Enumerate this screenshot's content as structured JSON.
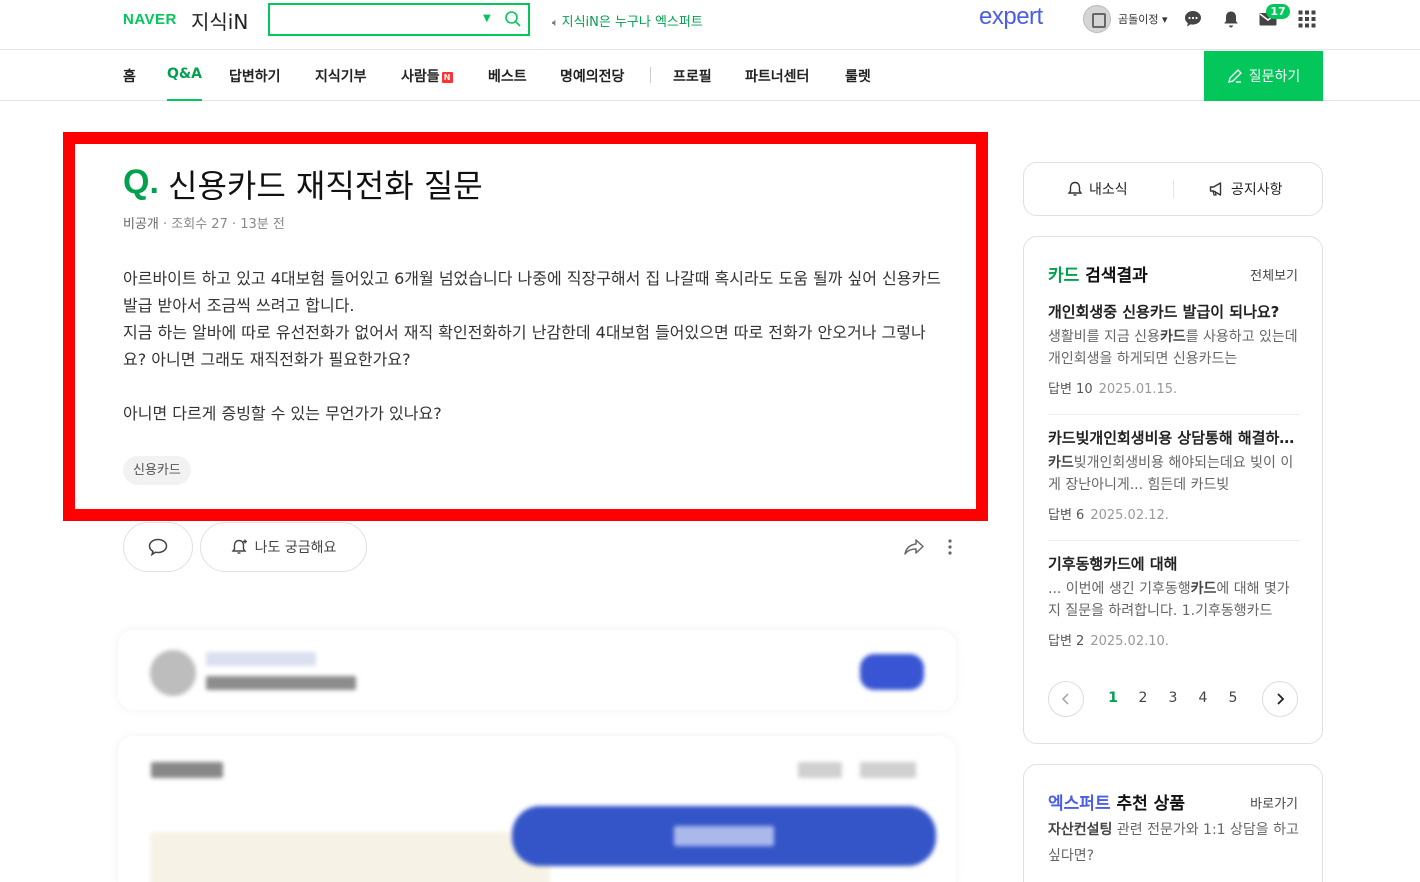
{
  "header": {
    "logo_naver": "NAVER",
    "logo_kin": "지식iN",
    "search_placeholder": "",
    "notice": "지식iN은 누구나 엑스퍼트",
    "expert_logo": "expert",
    "username": "곰돌이정",
    "mail_count": "17"
  },
  "nav": {
    "items": [
      "홈",
      "Q&A",
      "답변하기",
      "지식기부",
      "사람들",
      "베스트",
      "명예의전당",
      "프로필",
      "파트너센터",
      "룰렛"
    ],
    "new_badge": "N",
    "ask_button": "질문하기"
  },
  "question": {
    "q_mark": "Q.",
    "title": "신용카드 재직전화 질문",
    "author": "비공개",
    "views": "조회수 27",
    "time": "13분 전",
    "body_lines": [
      "아르바이트 하고 있고 4대보험 들어있고 6개월 넘었습니다 나중에 직장구해서 집 나갈때 혹시라도 도움 될까 싶어 신용카드 발급 받아서 조금씩 쓰려고 합니다.",
      "지금 하는 알바에 따로 유선전화가 없어서 재직 확인전화하기 난감한데 4대보험 들어있으면 따로 전화가 안오거나 그렇나요? 아니면 그래도 재직전화가 필요한가요?",
      "아니면 다르게 증빙할 수 있는 무언가가 있나요?"
    ],
    "tag": "신용카드",
    "curious_button": "나도 궁금해요"
  },
  "sidebar": {
    "my_news": "내소식",
    "notices": "공지사항",
    "search_keyword": "카드",
    "search_suffix": " 검색결과",
    "view_all": "전체보기",
    "results": [
      {
        "title": "개인회생중 신용카드 발급이 되나요?",
        "snippet_pre": "생활비를 지금 신용",
        "snippet_kw": "카드",
        "snippet_post": "를 사용하고 있는데 개인회생을 하게되면 신용카드는",
        "answers": "답변 10",
        "date": "2025.01.15."
      },
      {
        "title": "카드빚개인회생비용 상담통해 해결하세요",
        "snippet_pre": "",
        "snippet_kw": "카드",
        "snippet_post": "빚개인회생비용 해야되는데요 빚이 이게 장난아니게... 힘든데 카드빚",
        "answers": "답변 6",
        "date": "2025.02.12."
      },
      {
        "title": "기후동행카드에 대해",
        "snippet_pre": "... 이번에 생긴 기후동행",
        "snippet_kw": "카드",
        "snippet_post": "에 대해 몇가지 질문을 하려합니다. 1.기후동행카드",
        "answers": "답변 2",
        "date": "2025.02.10."
      }
    ],
    "pages": [
      "1",
      "2",
      "3",
      "4",
      "5"
    ],
    "expert_keyword": "엑스퍼트",
    "expert_title_rest": " 추천 상품",
    "expert_link": "바로가기",
    "expert_desc_bold": "자산컨설팅",
    "expert_desc_rest": " 관련 전문가와 1:1 상담을 하고 싶다면?"
  },
  "colors": {
    "brand_green": "#03c75a",
    "expert_blue": "#4a5ee8",
    "highlight_red": "#ff0000"
  }
}
